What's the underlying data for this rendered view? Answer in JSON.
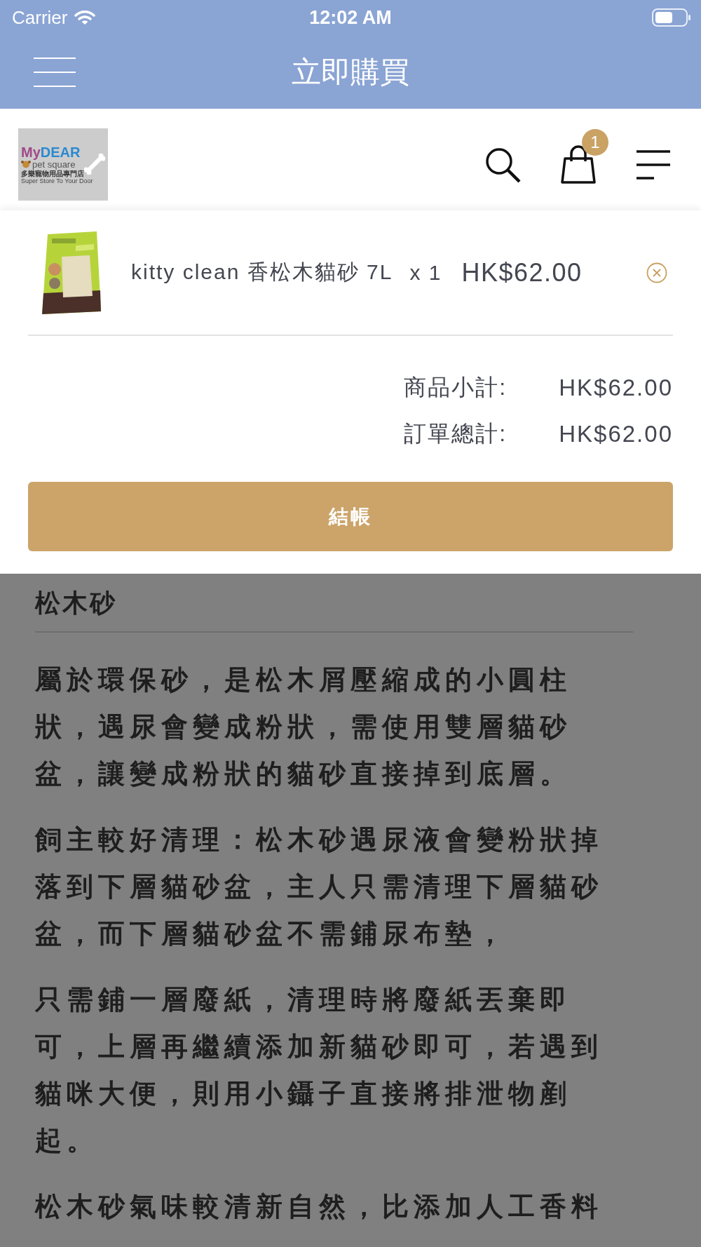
{
  "status_bar": {
    "carrier": "Carrier",
    "time": "12:02 AM"
  },
  "nav_bar": {
    "title": "立即購買"
  },
  "header": {
    "logo": {
      "name_start": "My",
      "name_end": "DEAR",
      "subtitle": "pet square",
      "tagline_zh": "多樂寵物用品專門店",
      "tagline_en": "Super Store To Your Door"
    },
    "cart_count": "1"
  },
  "cart": {
    "items": [
      {
        "name": "kitty clean 香松木貓砂 7L",
        "quantity": "x 1",
        "price": "HK$62.00"
      }
    ],
    "summary": [
      {
        "label": "商品小計:",
        "value": "HK$62.00"
      },
      {
        "label": "訂單總計:",
        "value": "HK$62.00"
      }
    ],
    "checkout_label": "結帳"
  },
  "content": {
    "heading": "松木砂",
    "paragraphs": [
      "屬於環保砂，是松木屑壓縮成的小圓柱狀，遇尿會變成粉狀，需使用雙層貓砂盆，讓變成粉狀的貓砂直接掉到底層。",
      "飼主較好清理：松木砂遇尿液會變粉狀掉落到下層貓砂盆，主人只需清理下層貓砂盆，而下層貓砂盆不需鋪尿布墊，",
      "只需鋪一層廢紙，清理時將廢紙丟棄即可，上層再繼續添加新貓砂即可，若遇到貓咪大便，則用小鑷子直接將排泄物剷起。",
      "松木砂氣味較清新自然，比添加人工香料"
    ]
  }
}
